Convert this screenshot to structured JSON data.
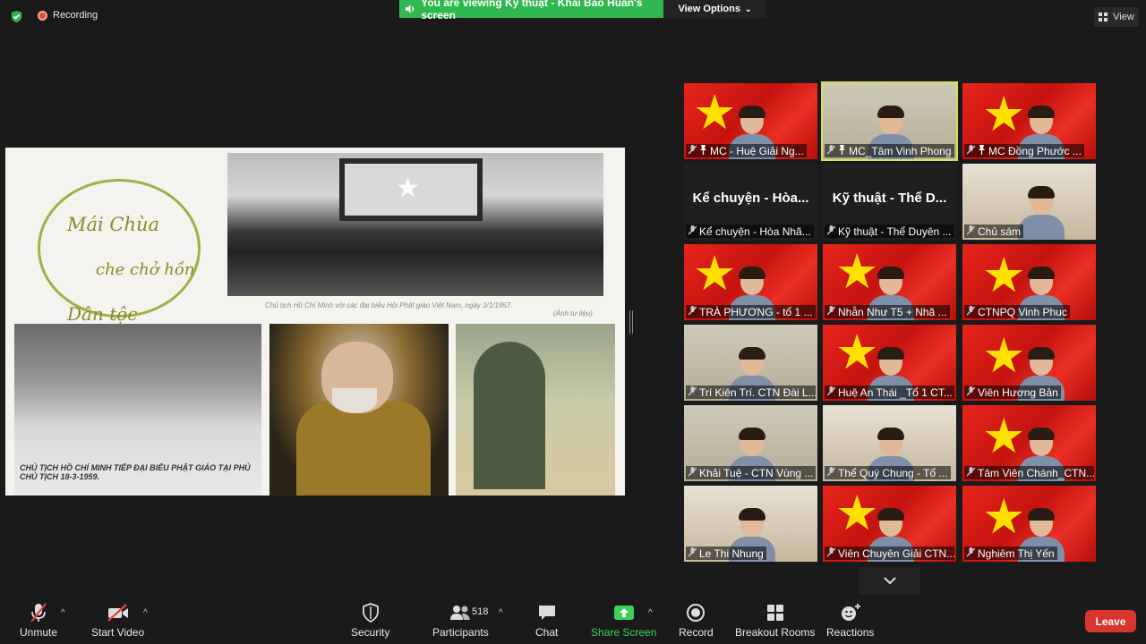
{
  "top": {
    "recording_label": "Recording",
    "viewing_banner": "You are viewing Kỹ thuật - Khải Bảo Huấn's screen",
    "view_options": "View Options",
    "view_label": "View"
  },
  "shared_screen": {
    "logo_line1": "Mái Chùa",
    "logo_line2": "che chở hồn",
    "logo_line3": "Dân tộc",
    "caption_top": "Chủ tịch Hồ Chí Minh với các đại biểu Hội Phật giáo Việt Nam, ngày 3/1/1957.",
    "caption_top_source": "(Ảnh tư liệu)",
    "caption_bottom_left": "CHỦ TỊCH HỒ CHÍ MINH TIẾP ĐẠI BIỂU PHẬT GIÁO TẠI PHỦ CHỦ TỊCH 18-3-1959."
  },
  "gallery": {
    "tiles": [
      {
        "name": "MC - Huệ Giải Ng...",
        "pinned": true,
        "bg": "flag",
        "active": false
      },
      {
        "name": "MC_Tâm Vinh Phong",
        "pinned": true,
        "bg": "room",
        "active": true
      },
      {
        "name": "MC Đồng Phước ...",
        "pinned": true,
        "bg": "flag",
        "active": false
      },
      {
        "name": "Kể chuyện - Hòa Nhã...",
        "big_name": "Kể chuyện - Hòa...",
        "bg": "black"
      },
      {
        "name": "Kỹ thuật - Thể Duyên ...",
        "big_name": "Kỹ thuật - Thể D...",
        "bg": "black"
      },
      {
        "name": "Chủ sám",
        "bg": "photo"
      },
      {
        "name": "TRÀ PHƯƠNG - tổ 1 ...",
        "bg": "flag"
      },
      {
        "name": "Nhẫn Như T5 + Nhã ...",
        "bg": "flag"
      },
      {
        "name": "CTNPQ Vinh Phuc",
        "bg": "flag"
      },
      {
        "name": "Trí Kiên Trí. CTN Đài L...",
        "bg": "room"
      },
      {
        "name": "Huệ An Thái _Tổ 1 CT...",
        "bg": "flag"
      },
      {
        "name": "Viên Hương Bản",
        "bg": "flag"
      },
      {
        "name": "Khải Tuệ - CTN Vùng ...",
        "bg": "room"
      },
      {
        "name": "Thể Quý Chung - Tổ ...",
        "bg": "photo"
      },
      {
        "name": "Tâm Viên Chánh_CTN...",
        "bg": "flag"
      },
      {
        "name": "Le Thi Nhung",
        "bg": "photo"
      },
      {
        "name": "Viên Chuyên Giải CTN...",
        "bg": "flag"
      },
      {
        "name": "Nghiêm Thị Yến",
        "bg": "flag"
      }
    ]
  },
  "toolbar": {
    "unmute": "Unmute",
    "start_video": "Start Video",
    "security": "Security",
    "participants": "Participants",
    "participants_count": "518",
    "chat": "Chat",
    "share_screen": "Share Screen",
    "record": "Record",
    "breakout_rooms": "Breakout Rooms",
    "reactions": "Reactions",
    "leave": "Leave"
  },
  "colors": {
    "banner_green": "#2fb84f",
    "leave_red": "#d9352d",
    "share_green": "#3fd05a",
    "active_outline": "#d4e157"
  }
}
